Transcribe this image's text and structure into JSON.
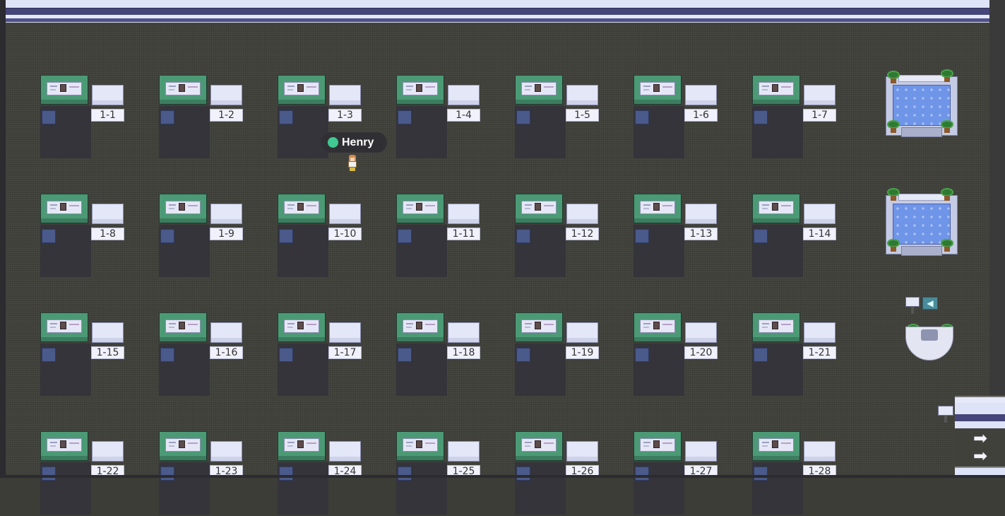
{
  "map": {
    "desk_rows": [
      [
        "1-1",
        "1-2",
        "1-3",
        "1-4",
        "1-5",
        "1-6",
        "1-7"
      ],
      [
        "1-8",
        "1-9",
        "1-10",
        "1-11",
        "1-12",
        "1-13",
        "1-14"
      ],
      [
        "1-15",
        "1-16",
        "1-17",
        "1-18",
        "1-19",
        "1-20",
        "1-21"
      ],
      [
        "1-22",
        "1-23",
        "1-24",
        "1-25",
        "1-26",
        "1-27",
        "1-28"
      ]
    ]
  },
  "player": {
    "name": "Henry",
    "status_color": "#40c990"
  },
  "icons": {
    "megaphone": "megaphone-icon",
    "exit_arrow": "arrow-right-icon",
    "exit_arrow_glyph": "➡"
  },
  "colors": {
    "floor": "#41413c",
    "wall": "#dfe3f8",
    "wall_stripe": "#46467a",
    "monitor": "#4b9a75",
    "water": "#6f95e8"
  }
}
